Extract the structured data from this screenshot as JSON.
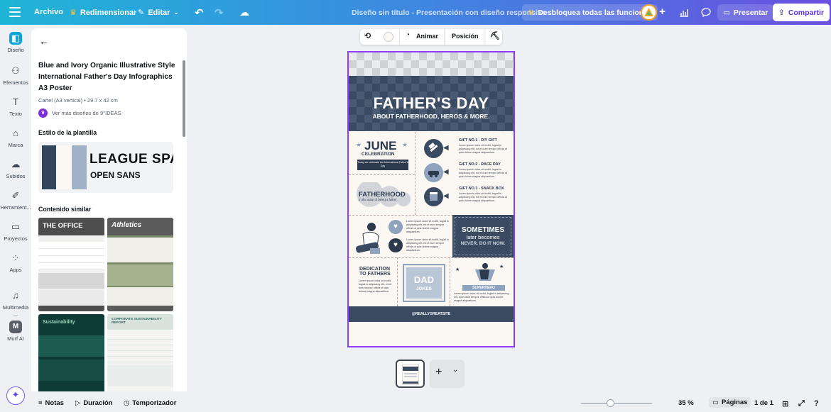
{
  "topbar": {
    "menu_icon": "hamburger-icon",
    "file": "Archivo",
    "resize": "Redimensionar",
    "edit": "Editar",
    "doc_title": "Diseño sin título - Presentación con diseño responsive",
    "unlock": "Desbloquea todas las funciones",
    "present": "Presentar",
    "share": "Compartir"
  },
  "rail": [
    {
      "label": "Diseño",
      "icon": "design-icon"
    },
    {
      "label": "Elementos",
      "icon": "elements-icon"
    },
    {
      "label": "Texto",
      "icon": "text-icon"
    },
    {
      "label": "Marca",
      "icon": "brand-icon"
    },
    {
      "label": "Subidos",
      "icon": "upload-icon"
    },
    {
      "label": "Herramient...",
      "icon": "tools-icon"
    },
    {
      "label": "Proyectos",
      "icon": "folder-icon"
    },
    {
      "label": "Apps",
      "icon": "apps-icon"
    },
    {
      "label": "Multimedia ...",
      "icon": "media-icon"
    },
    {
      "label": "Murf AI",
      "icon": "murf-icon"
    }
  ],
  "panel": {
    "title": "Blue and Ivory Organic Illustrative Style International Father's Day Infographics A3 Poster",
    "subtitle": "Cartel (A3 vertical) • 29.7 x 42 cm",
    "creator_initial": "9",
    "creator_link": "Ver más diseños de 9°IDEAS",
    "style_heading": "Estilo de la plantilla",
    "font_heading": "LEAGUE SPA",
    "font_body": "OPEN SANS",
    "similar_heading": "Contenido similar",
    "swatches": [
      "#34465e",
      "#fbf7f3",
      "#9fb2c8"
    ],
    "thumbs": [
      {
        "label": "THE OFFICE"
      },
      {
        "label": "Athletics"
      },
      {
        "label": "Sustainability"
      },
      {
        "label": "CORPORATE SUSTAINABILITY REPORT"
      }
    ]
  },
  "float_toolbar": {
    "animate": "Animar",
    "position": "Posición"
  },
  "poster": {
    "title": "FATHER'S DAY",
    "subtitle": "ABOUT FATHERHOOD, HEROS & MORE.",
    "june": "JUNE",
    "celebration": "CELEBRATION",
    "ribbon": "Today we celebrate the International Father's Day",
    "fatherhood": "FATHERHOOD",
    "fatherhood_sub": "In the state of being a father",
    "gifts": [
      {
        "title": "GIFT NO.1 - DIY GIFT"
      },
      {
        "title": "GIFT NO.2 - RACE DAY"
      },
      {
        "title": "GIFT NO.3 - SNACK BOX"
      }
    ],
    "lorem": "Lorem ipsum dolor sit mollit, fugiat in adipiscing elit, ed et dum tempor officia ut quis dolore magna aliquaelium.",
    "sometimes_1": "SOMETIMES",
    "sometimes_2": "later becomes",
    "sometimes_3": "NEVER. DO IT NOW.",
    "dedication": "DEDICATION TO FATHERS",
    "dad": "DAD",
    "jokes": "JOKES",
    "superhero": "SUPERHERO",
    "footer": "@REALLYGREATSITE"
  },
  "bottombar": {
    "notes": "Notas",
    "duration": "Duración",
    "timer": "Temporizador",
    "zoom": "35 %",
    "pages": "Páginas",
    "page_count": "1 de 1"
  },
  "colors": {
    "accent": "#8b3dff",
    "poster_dark": "#3a4a60",
    "poster_light": "#8fa3bf"
  }
}
